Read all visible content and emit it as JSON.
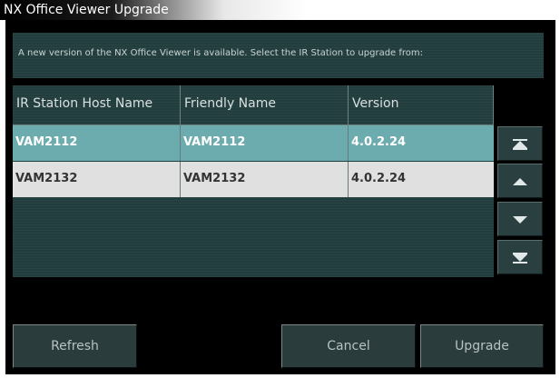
{
  "window": {
    "title": "NX Office Viewer Upgrade"
  },
  "info": {
    "message": "A new version of the NX Office Viewer is available. Select the IR Station to upgrade from:"
  },
  "table": {
    "headers": [
      "IR Station Host Name",
      "Friendly Name",
      "Version"
    ],
    "rows": [
      {
        "host": "VAM2112",
        "friendly": "VAM2112",
        "version": "4.0.2.24",
        "selected": true
      },
      {
        "host": "VAM2132",
        "friendly": "VAM2132",
        "version": "4.0.2.24",
        "selected": false
      }
    ]
  },
  "scroll_buttons": [
    "scroll-top-icon",
    "scroll-up-icon",
    "scroll-down-icon",
    "scroll-bottom-icon"
  ],
  "buttons": {
    "refresh": "Refresh",
    "cancel": "Cancel",
    "upgrade": "Upgrade"
  },
  "colors": {
    "panel": "#223d3d",
    "selected_row": "#6cabae",
    "row": "#e0e0e0",
    "button": "#2b3c3c"
  }
}
